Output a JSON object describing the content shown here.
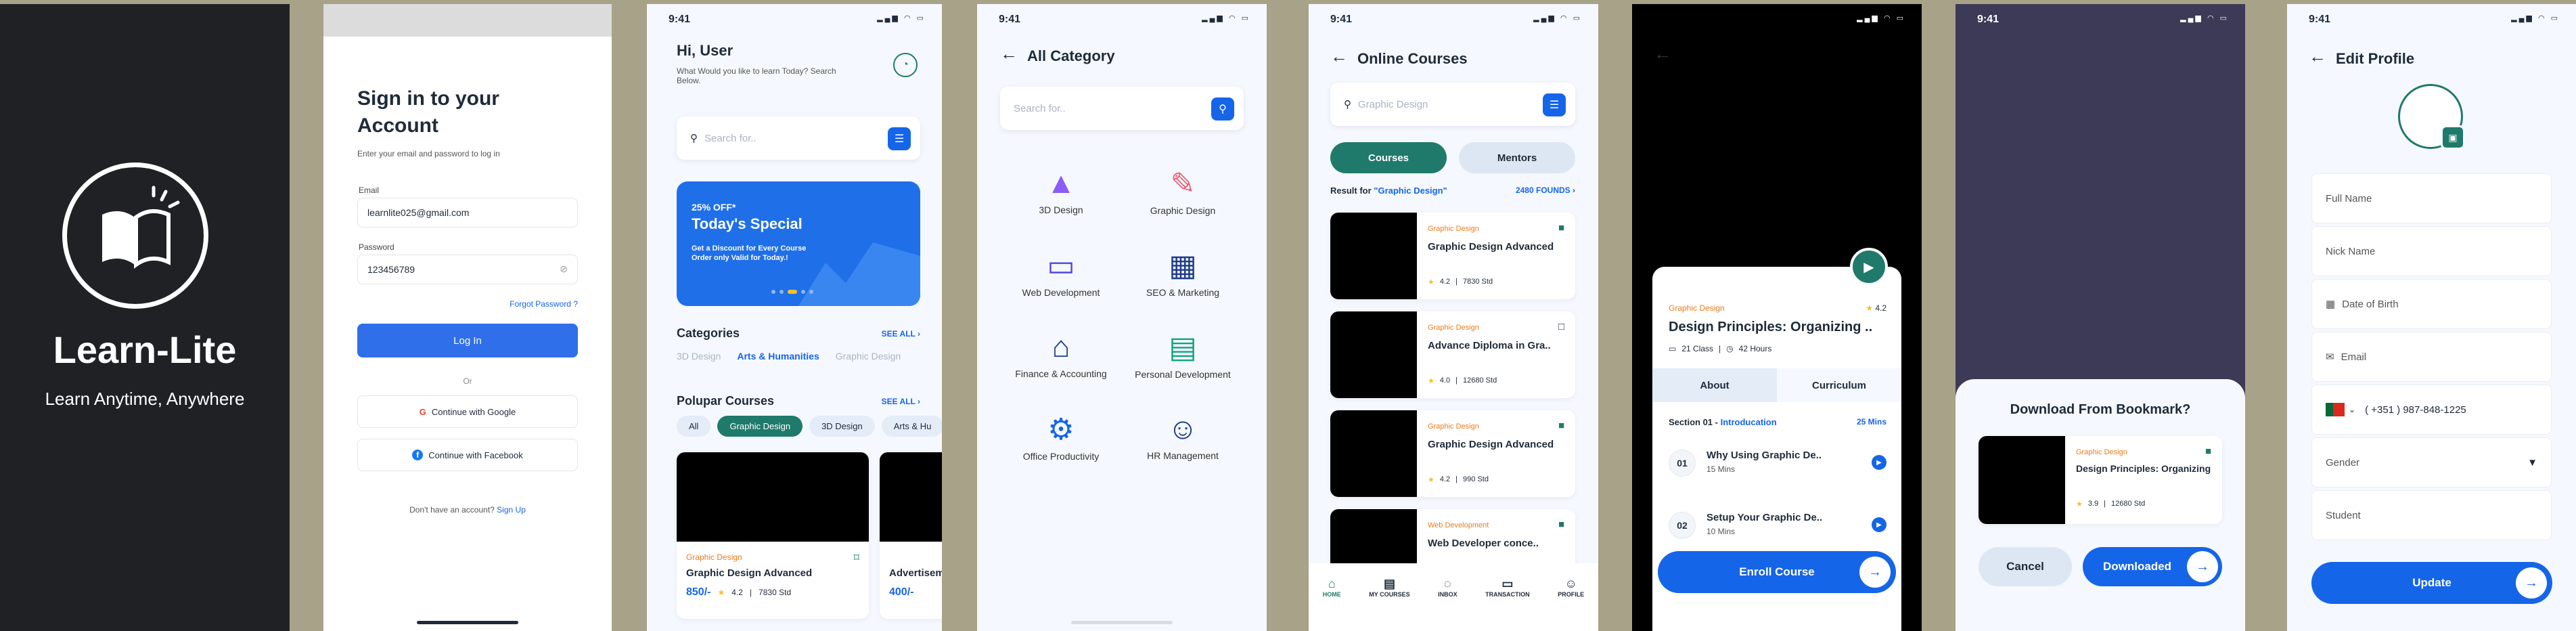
{
  "splash": {
    "logo_name": "Learn-Lite",
    "tagline": "Learn Anytime, Anywhere"
  },
  "signin": {
    "title": "Sign in to your Account",
    "subtitle": "Enter your email and password to log in",
    "email_label": "Email",
    "email_value": "learnlite025@gmail.com",
    "password_label": "Password",
    "password_value": "123456789",
    "forgot": "Forgot Password ?",
    "login": "Log In",
    "or": "Or",
    "google": "Continue with Google",
    "facebook": "Continue with Facebook",
    "no_account": "Don't have an account?",
    "signup": "Sign Up"
  },
  "status": {
    "time": "9:41"
  },
  "home": {
    "greeting": "Hi, User",
    "question": "What Would you like to learn Today? Search Below.",
    "search_placeholder": "Search for..",
    "promo_pct": "25% OFF*",
    "promo_title": "Today's Special",
    "promo_text": "Get a Discount for Every Course Order only Valid for Today.!",
    "categories_title": "Categories",
    "see_all": "SEE ALL",
    "categories": [
      "3D Design",
      "Arts & Humanities",
      "Graphic Design"
    ],
    "popular_title": "Polupar Courses",
    "filters": [
      "All",
      "Graphic Design",
      "3D Design",
      "Arts & Hu"
    ],
    "course1": {
      "cat": "Graphic Design",
      "title": "Graphic Design Advanced",
      "price": "850/-",
      "rating": "4.2",
      "students": "7830 Std"
    },
    "course2": {
      "title": "Advertisem",
      "price": "400/-"
    }
  },
  "category": {
    "title": "All Category",
    "search_placeholder": "Search for..",
    "items": [
      "3D Design",
      "Graphic Design",
      "Web Development",
      "SEO & Marketing",
      "Finance & Accounting",
      "Personal Development",
      "Office Productivity",
      "HR Management"
    ]
  },
  "online": {
    "title": "Online Courses",
    "search_placeholder": "Graphic Design",
    "tab_courses": "Courses",
    "tab_mentors": "Mentors",
    "result_prefix": "Result for",
    "result_query": "\"Graphic Design\"",
    "found": "2480 FOUNDS",
    "courses": [
      {
        "cat": "Graphic Design",
        "title": "Graphic Design Advanced",
        "rating": "4.2",
        "students": "7830 Std"
      },
      {
        "cat": "Graphic Design",
        "title": "Advance Diploma in Gra..",
        "rating": "4.0",
        "students": "12680 Std"
      },
      {
        "cat": "Graphic Design",
        "title": "Graphic Design Advanced",
        "rating": "4.2",
        "students": "990 Std"
      },
      {
        "cat": "Web Development",
        "title": "Web Developer conce..",
        "rating": "",
        "students": ""
      }
    ],
    "nav": [
      "HOME",
      "MY COURSES",
      "INBOX",
      "TRANSACTION",
      "PROFILE"
    ]
  },
  "detail": {
    "cat": "Graphic Design",
    "rating": "4.2",
    "title": "Design Principles: Organizing ..",
    "classes": "21 Class",
    "hours": "42 Hours",
    "tab_about": "About",
    "tab_curriculum": "Curriculum",
    "section": "Section 01 -",
    "section_name": "Introducation",
    "section_mins": "25 Mins",
    "lessons": [
      {
        "num": "01",
        "title": "Why Using Graphic De..",
        "mins": "15 Mins"
      },
      {
        "num": "02",
        "title": "Setup Your Graphic De..",
        "mins": "10 Mins"
      }
    ],
    "enroll": "Enroll Course"
  },
  "download": {
    "title": "Download From Bookmark?",
    "cat": "Graphic Design",
    "course": "Design Principles: Organizing",
    "rating": "3.9",
    "students": "12680 Std",
    "cancel": "Cancel",
    "downloaded": "Downloaded"
  },
  "profile": {
    "title": "Edit Profile",
    "full_name": "Full Name",
    "nick_name": "Nick Name",
    "dob": "Date of Birth",
    "email": "Email",
    "phone": "( +351 )  987-848-1225",
    "gender": "Gender",
    "role": "Student",
    "update": "Update"
  }
}
